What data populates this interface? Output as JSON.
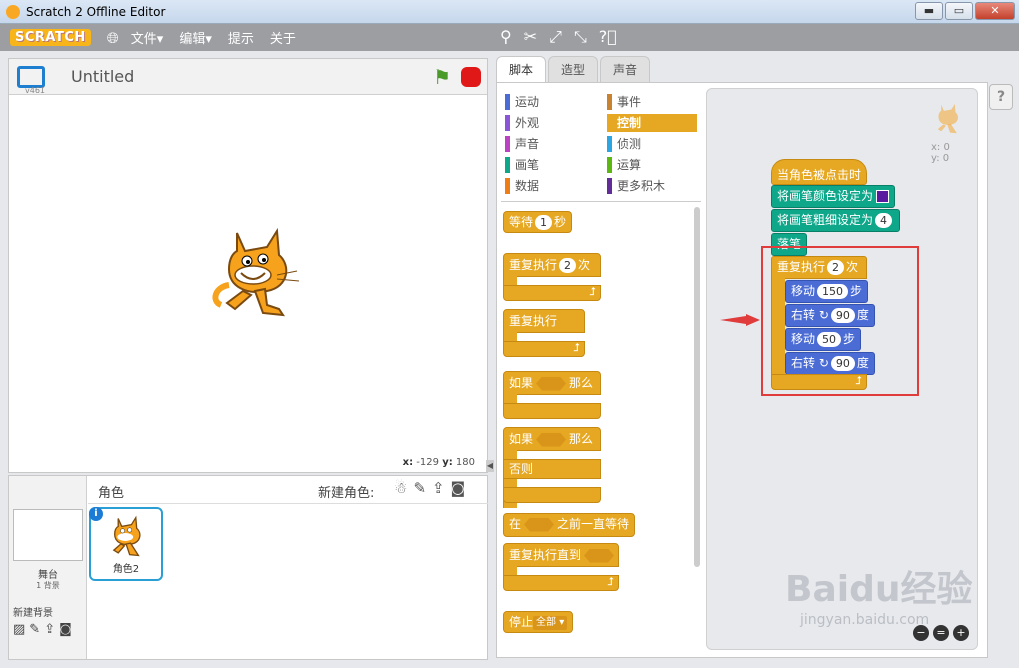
{
  "window": {
    "title": "Scratch 2 Offline Editor",
    "minimize": "▬",
    "maximize": "▭",
    "close": "✕"
  },
  "menubar": {
    "logo": "SCRATCH",
    "items": [
      "文件▾",
      "编辑▾",
      "提示",
      "关于"
    ],
    "tool_icons": [
      "copy-stamp-icon",
      "cut-icon",
      "grow-icon",
      "shrink-icon",
      "help-icon"
    ]
  },
  "stage": {
    "version": "v461",
    "project_title": "Untitled",
    "coords": {
      "x_label": "x:",
      "x": "-129",
      "y_label": "y:",
      "y": "180"
    }
  },
  "sprites": {
    "title": "角色",
    "new_sprite_label": "新建角色:",
    "stage_label": "舞台",
    "backdrop_count": "1 背景",
    "new_backdrop_label": "新建背景",
    "sprite_name": "角色2"
  },
  "tabs": [
    "脚本",
    "造型",
    "声音"
  ],
  "categories": [
    {
      "label": "运动",
      "color": "#4a6cd4"
    },
    {
      "label": "事件",
      "color": "#c88330"
    },
    {
      "label": "外观",
      "color": "#8a55d7"
    },
    {
      "label": "控制",
      "color": "#e6a822",
      "active": true
    },
    {
      "label": "声音",
      "color": "#bb42c3"
    },
    {
      "label": "侦测",
      "color": "#2ca5e2"
    },
    {
      "label": "画笔",
      "color": "#0fa78a"
    },
    {
      "label": "运算",
      "color": "#5cb712"
    },
    {
      "label": "数据",
      "color": "#ee7d16"
    },
    {
      "label": "更多积木",
      "color": "#632d99"
    }
  ],
  "palette": {
    "wait": {
      "a": "等待",
      "v": "1",
      "b": "秒"
    },
    "repeat": {
      "a": "重复执行",
      "v": "2",
      "b": "次"
    },
    "forever": "重复执行",
    "if": {
      "a": "如果",
      "b": "那么"
    },
    "ifelse": {
      "a": "如果",
      "b": "那么",
      "else": "否则"
    },
    "wait_until": {
      "a": "在",
      "b": "之前一直等待"
    },
    "repeat_until": "重复执行直到",
    "stop": {
      "a": "停止",
      "v": "全部"
    }
  },
  "script": {
    "hat": "当角色被点击时",
    "set_color": "将画笔颜色设定为",
    "set_size": {
      "a": "将画笔粗细设定为",
      "v": "4"
    },
    "pen_down": "落笔",
    "repeat": {
      "a": "重复执行",
      "v": "2",
      "b": "次"
    },
    "move1": {
      "a": "移动",
      "v": "150",
      "b": "步"
    },
    "turn1": {
      "a": "右转",
      "v": "90",
      "b": "度"
    },
    "move2": {
      "a": "移动",
      "v": "50",
      "b": "步"
    },
    "turn2": {
      "a": "右转",
      "v": "90",
      "b": "度"
    },
    "sprite_x": "x: 0",
    "sprite_y": "y: 0"
  },
  "watermark": {
    "brand": "Baidu经验",
    "url": "jingyan.baidu.com"
  },
  "colors": {
    "control": "#e6a822",
    "pen": "#0fa78a",
    "motion": "#4a6cd4",
    "highlight": "#e03c3c"
  }
}
